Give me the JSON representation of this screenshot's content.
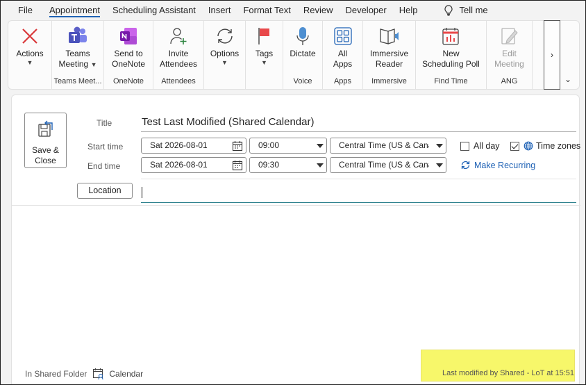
{
  "menu": {
    "items": [
      "File",
      "Appointment",
      "Scheduling Assistant",
      "Insert",
      "Format Text",
      "Review",
      "Developer",
      "Help"
    ],
    "active_index": 1,
    "tell_me": "Tell me"
  },
  "ribbon": {
    "groups": [
      {
        "label": "",
        "buttons": [
          {
            "line1": "Actions",
            "line2": "",
            "caret": true,
            "icon": "close-x-icon"
          }
        ]
      },
      {
        "label": "Teams Meet...",
        "buttons": [
          {
            "line1": "Teams",
            "line2": "Meeting",
            "caret": true,
            "icon": "teams-icon"
          }
        ]
      },
      {
        "label": "OneNote",
        "buttons": [
          {
            "line1": "Send to",
            "line2": "OneNote",
            "caret": false,
            "icon": "onenote-icon"
          }
        ]
      },
      {
        "label": "Attendees",
        "buttons": [
          {
            "line1": "Invite",
            "line2": "Attendees",
            "caret": false,
            "icon": "invite-person-icon"
          }
        ]
      },
      {
        "label": "",
        "buttons": [
          {
            "line1": "Options",
            "line2": "",
            "caret": true,
            "icon": "options-sync-icon"
          }
        ]
      },
      {
        "label": "",
        "buttons": [
          {
            "line1": "Tags",
            "line2": "",
            "caret": true,
            "icon": "flag-icon"
          }
        ]
      },
      {
        "label": "Voice",
        "buttons": [
          {
            "line1": "Dictate",
            "line2": "",
            "caret": false,
            "icon": "microphone-icon"
          }
        ]
      },
      {
        "label": "Apps",
        "buttons": [
          {
            "line1": "All",
            "line2": "Apps",
            "caret": false,
            "icon": "apps-grid-icon"
          }
        ]
      },
      {
        "label": "Immersive",
        "buttons": [
          {
            "line1": "Immersive",
            "line2": "Reader",
            "caret": false,
            "icon": "immersive-reader-icon"
          }
        ]
      },
      {
        "label": "Find Time",
        "buttons": [
          {
            "line1": "New",
            "line2": "Scheduling Poll",
            "caret": false,
            "icon": "scheduling-poll-icon"
          }
        ]
      },
      {
        "label": "ANG",
        "buttons": [
          {
            "line1": "Edit",
            "line2": "Meeting",
            "caret": false,
            "icon": "edit-meeting-icon",
            "disabled": true
          }
        ]
      }
    ],
    "scroll_glyph": "›",
    "collapse_glyph": "⌄"
  },
  "form": {
    "save_close": {
      "line1": "Save &",
      "line2": "Close"
    },
    "title_label": "Title",
    "title_value": "Test Last Modified (Shared Calendar)",
    "start_label": "Start time",
    "end_label": "End time",
    "start_date": "Sat 2026-08-01",
    "start_time": "09:00",
    "end_date": "Sat 2026-08-01",
    "end_time": "09:30",
    "timezone_start": "Central Time (US & Canada)",
    "timezone_end": "Central Time (US & Canada)",
    "all_day_label": "All day",
    "all_day_checked": false,
    "time_zones_label": "Time zones",
    "time_zones_checked": true,
    "make_recurring": "Make Recurring",
    "location_button": "Location",
    "location_value": ""
  },
  "footer": {
    "in_shared_folder": "In Shared Folder",
    "folder_name": "Calendar",
    "last_modified": "Last modified by Shared - LoT at 15:51"
  },
  "colors": {
    "accent": "#1f62b5",
    "highlight": "#f7f76a",
    "teams": "#5b5fc7",
    "onenote": "#7719aa"
  }
}
